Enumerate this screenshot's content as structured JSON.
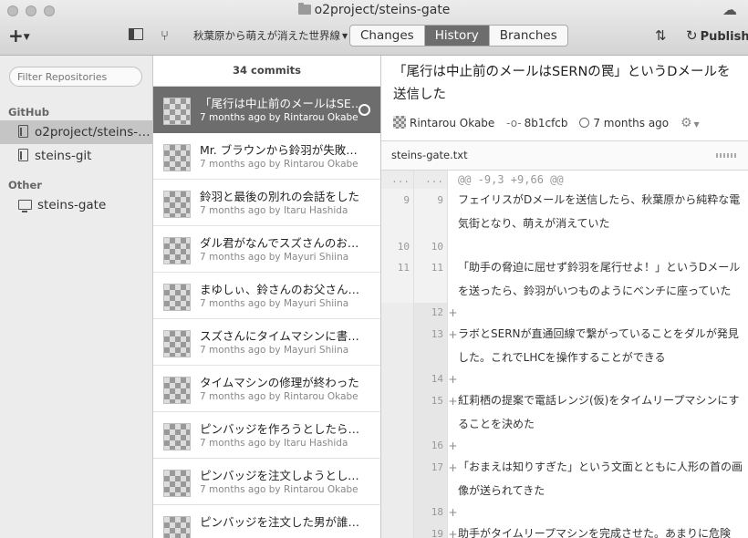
{
  "window": {
    "title": "o2project/steins-gate"
  },
  "toolbar": {
    "branch": "秋葉原から萌えが消えた世界線",
    "tabs": [
      "Changes",
      "History",
      "Branches"
    ],
    "selected_tab": "History",
    "publish": "Publish"
  },
  "sidebar": {
    "filter_placeholder": "Filter Repositories",
    "github_label": "GitHub",
    "github_repos": [
      "o2project/steins-…",
      "steins-git"
    ],
    "other_label": "Other",
    "other_repos": [
      "steins-gate"
    ]
  },
  "commits": {
    "count_label": "34 commits",
    "items": [
      {
        "message": "「尾行は中止前のメールはSERNの罠」というDメールを送信した",
        "meta": "7 months ago by Rintarou Okabe"
      },
      {
        "message": "Mr. ブラウンから鈴羽が失敗した",
        "meta": "7 months ago by Rintarou Okabe"
      },
      {
        "message": "鈴羽と最後の別れの会話をした",
        "meta": "7 months ago by Itaru Hashida"
      },
      {
        "message": "ダル君がなんでスズさんのお父さん",
        "meta": "7 months ago by Mayuri Shiina"
      },
      {
        "message": "まゆしぃ、鈴さんのお父さんが分かった",
        "meta": "7 months ago by Mayuri Shiina"
      },
      {
        "message": "スズさんにタイムマシンに書いてある",
        "meta": "7 months ago by Mayuri Shiina"
      },
      {
        "message": "タイムマシンの修理が終わった",
        "meta": "7 months ago by Rintarou Okabe"
      },
      {
        "message": "ピンバッジを作ろうとしたらオカリン",
        "meta": "7 months ago by Itaru Hashida"
      },
      {
        "message": "ピンバッジを注文しようとしている",
        "meta": "7 months ago by Rintarou Okabe"
      },
      {
        "message": "ピンバッジを注文した男が誰かわかった",
        "meta": ""
      }
    ]
  },
  "detail": {
    "title": "「尾行は中止前のメールはSERNの罠」というDメールを送信した",
    "author": "Rintarou Okabe",
    "sha": "8b1cfcb",
    "time": "7 months ago",
    "file_name": "steins-gate.txt",
    "hunk_header": "@@ -9,3 +9,66 @@",
    "hunk_ellipsis": "...",
    "lines": [
      {
        "type": "ctx",
        "old": "9",
        "new": "9",
        "text": "フェイリスがDメールを送信したら、秋葉原から純粋な電気街となり、萌えが消えていた"
      },
      {
        "type": "ctx",
        "old": "10",
        "new": "10",
        "text": ""
      },
      {
        "type": "ctx",
        "old": "11",
        "new": "11",
        "text": "「助手の脅迫に屈せず鈴羽を尾行せよ！」というDメールを送ったら、鈴羽がいつものようにベンチに座っていた"
      },
      {
        "type": "add",
        "old": "",
        "new": "12",
        "text": ""
      },
      {
        "type": "add",
        "old": "",
        "new": "13",
        "text": "ラボとSERNが直通回線で繋がっていることをダルが発見した。これでLHCを操作することができる"
      },
      {
        "type": "add",
        "old": "",
        "new": "14",
        "text": ""
      },
      {
        "type": "add",
        "old": "",
        "new": "15",
        "text": "紅莉栖の提案で電話レンジ(仮)をタイムリープマシンにすることを決めた"
      },
      {
        "type": "add",
        "old": "",
        "new": "16",
        "text": ""
      },
      {
        "type": "add",
        "old": "",
        "new": "17",
        "text": "「おまえは知りすぎた」という文面とともに人形の首の画像が送られてきた"
      },
      {
        "type": "add",
        "old": "",
        "new": "18",
        "text": ""
      },
      {
        "type": "add",
        "old": "",
        "new": "19",
        "text": "助手がタイムリープマシンを完成させた。あまりに危険"
      }
    ]
  }
}
